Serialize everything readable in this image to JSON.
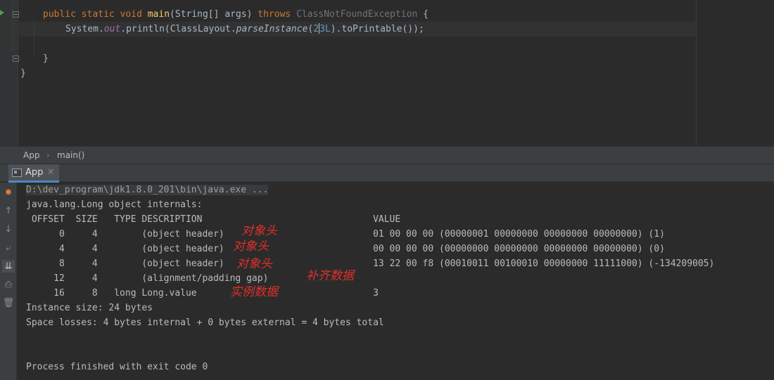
{
  "editor": {
    "line1": {
      "kw_public": "public",
      "kw_static": "static",
      "kw_void": "void",
      "method": "main",
      "params": "(String[] args)",
      "kw_throws": "throws",
      "exception": "ClassNotFoundException",
      "brace": "{"
    },
    "line2": {
      "system": "System.",
      "out": "out",
      "println": ".println(ClassLayout.",
      "parse": "parseInstance",
      "open": "(",
      "num_a": "2",
      "num_b": "3L",
      "rest": ").toPrintable());"
    },
    "line4": "}",
    "line5": "}"
  },
  "breadcrumb": {
    "class_name": "App",
    "separator": "›",
    "method_name": "main()"
  },
  "run_panel": {
    "tab_label": "App",
    "tab_close": "×"
  },
  "toolbar": {
    "icons": [
      "rerun-icon",
      "up-arrow-icon",
      "down-arrow-icon",
      "soft-wrap-icon",
      "scroll-to-end-icon",
      "print-icon",
      "trash-icon"
    ]
  },
  "console": {
    "command": "D:\\dev_program\\jdk1.8.0_201\\bin\\java.exe ...",
    "title": "java.lang.Long object internals:",
    "header": " OFFSET  SIZE   TYPE DESCRIPTION                               VALUE",
    "rows": [
      "      0     4        (object header)                           01 00 00 00 (00000001 00000000 00000000 00000000) (1)",
      "      4     4        (object header)                           00 00 00 00 (00000000 00000000 00000000 00000000) (0)",
      "      8     4        (object header)                           13 22 00 f8 (00010011 00100010 00000000 11111000) (-134209005)",
      "     12     4        (alignment/padding gap)",
      "     16     8   long Long.value                                3"
    ],
    "instance_size": "Instance size: 24 bytes",
    "space_losses": "Space losses: 4 bytes internal + 0 bytes external = 4 bytes total",
    "exit": "Process finished with exit code 0"
  },
  "annotations": {
    "object_header_1": "对象头",
    "object_header_2": "对象头",
    "object_header_3": "对象头",
    "padding_data": "补齐数据",
    "instance_data": "实例数据",
    "color": "#e0302a"
  }
}
